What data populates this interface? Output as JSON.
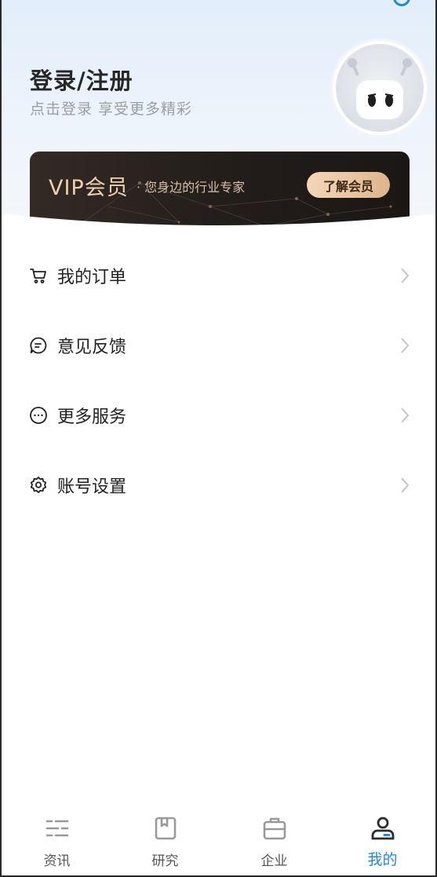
{
  "header": {
    "login_title": "登录/注册",
    "login_subtitle": "点击登录 享受更多精彩"
  },
  "vip": {
    "title": "VIP会员",
    "subtitle": "· 您身边的行业专家",
    "button_label": "了解会员"
  },
  "menu": {
    "items": [
      {
        "label": "我的订单",
        "icon": "cart-icon"
      },
      {
        "label": "意见反馈",
        "icon": "feedback-icon"
      },
      {
        "label": "更多服务",
        "icon": "more-icon"
      },
      {
        "label": "账号设置",
        "icon": "settings-icon"
      }
    ]
  },
  "tabbar": {
    "tabs": [
      {
        "label": "资讯",
        "icon": "news-icon"
      },
      {
        "label": "研究",
        "icon": "research-icon"
      },
      {
        "label": "企业",
        "icon": "enterprise-icon"
      },
      {
        "label": "我的",
        "icon": "profile-icon"
      }
    ],
    "active_index": 3
  },
  "colors": {
    "accent": "#1e88e5",
    "vip_gold": "#f0cfae",
    "vip_dark": "#221d1a"
  }
}
